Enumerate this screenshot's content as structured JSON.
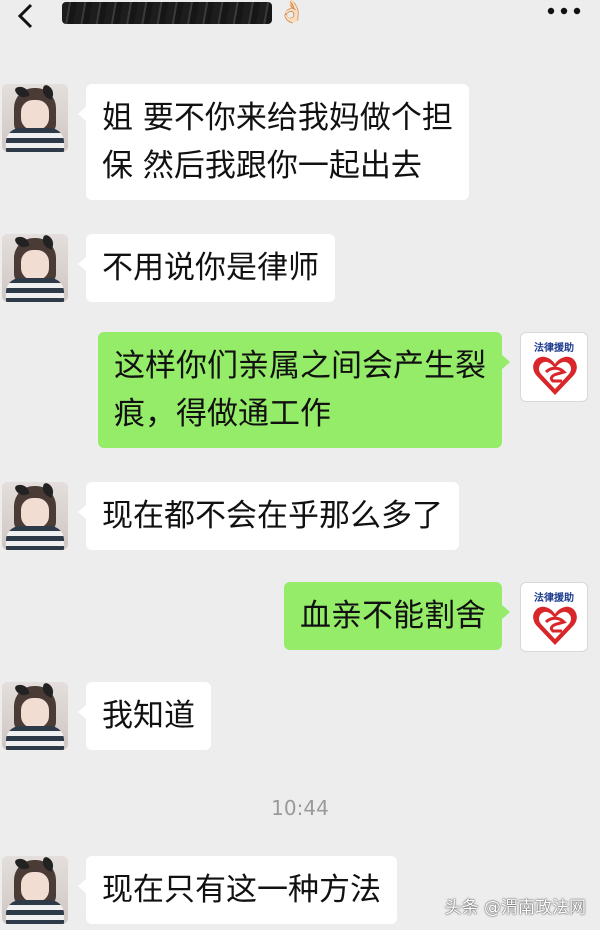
{
  "header": {
    "title": "",
    "emoji": "👌🏻",
    "back_icon": "chevron-left-icon",
    "more_icon": "ellipsis-icon"
  },
  "messages": [
    {
      "side": "left",
      "text_lines": [
        "姐 要不你来给我妈做个担",
        "保 然后我跟你一起出去"
      ]
    },
    {
      "side": "left",
      "text_lines": [
        "不用说你是律师"
      ]
    },
    {
      "side": "right",
      "text_lines": [
        "这样你们亲属之间会产生裂",
        "痕，得做通工作"
      ]
    },
    {
      "side": "left",
      "text_lines": [
        "现在都不会在乎那么多了"
      ]
    },
    {
      "side": "right",
      "text_lines": [
        "血亲不能割舍"
      ]
    },
    {
      "side": "left",
      "text_lines": [
        "我知道"
      ]
    },
    {
      "side": "left",
      "text_lines": [
        "现在只有这一种方法"
      ]
    }
  ],
  "timestamp": "10:44",
  "logo_text": "法律援助",
  "watermark": "头条 @渭南政法网",
  "colors": {
    "background": "#ededed",
    "incoming_bubble": "#ffffff",
    "outgoing_bubble": "#95ec69",
    "logo_blue": "#1b3a8c",
    "logo_red": "#d9262b"
  }
}
